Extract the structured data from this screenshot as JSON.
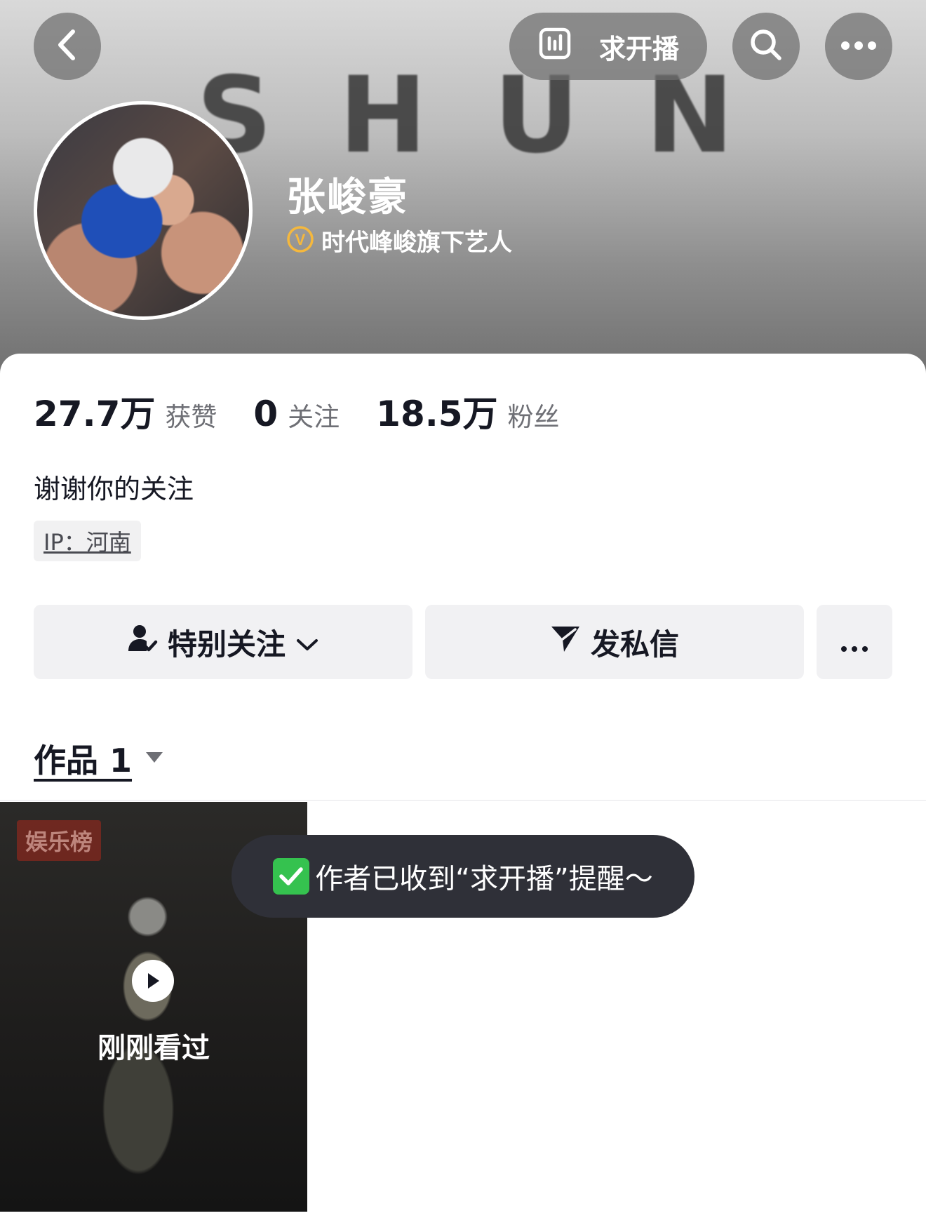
{
  "header": {
    "banner_text": "SHUN",
    "request_live_label": "求开播"
  },
  "profile": {
    "name": "张峻豪",
    "verification_text": "时代峰峻旗下艺人",
    "verification_badge_letter": "V"
  },
  "stats": [
    {
      "value": "27.7万",
      "label": "获赞"
    },
    {
      "value": "0",
      "label": "关注"
    },
    {
      "value": "18.5万",
      "label": "粉丝"
    }
  ],
  "bio": "谢谢你的关注",
  "ip_location": "IP：河南",
  "actions": {
    "follow_label": "特别关注",
    "message_label": "发私信"
  },
  "works": {
    "tab_label": "作品 1",
    "items": [
      {
        "badge": "娱乐榜",
        "caption": "刚刚看过"
      }
    ]
  },
  "toast": {
    "message": "作者已收到“求开播”提醒～"
  },
  "colors": {
    "accent_verify": "#f5b83d",
    "toast_bg": "#2f3038",
    "button_bg": "#f1f1f3"
  }
}
